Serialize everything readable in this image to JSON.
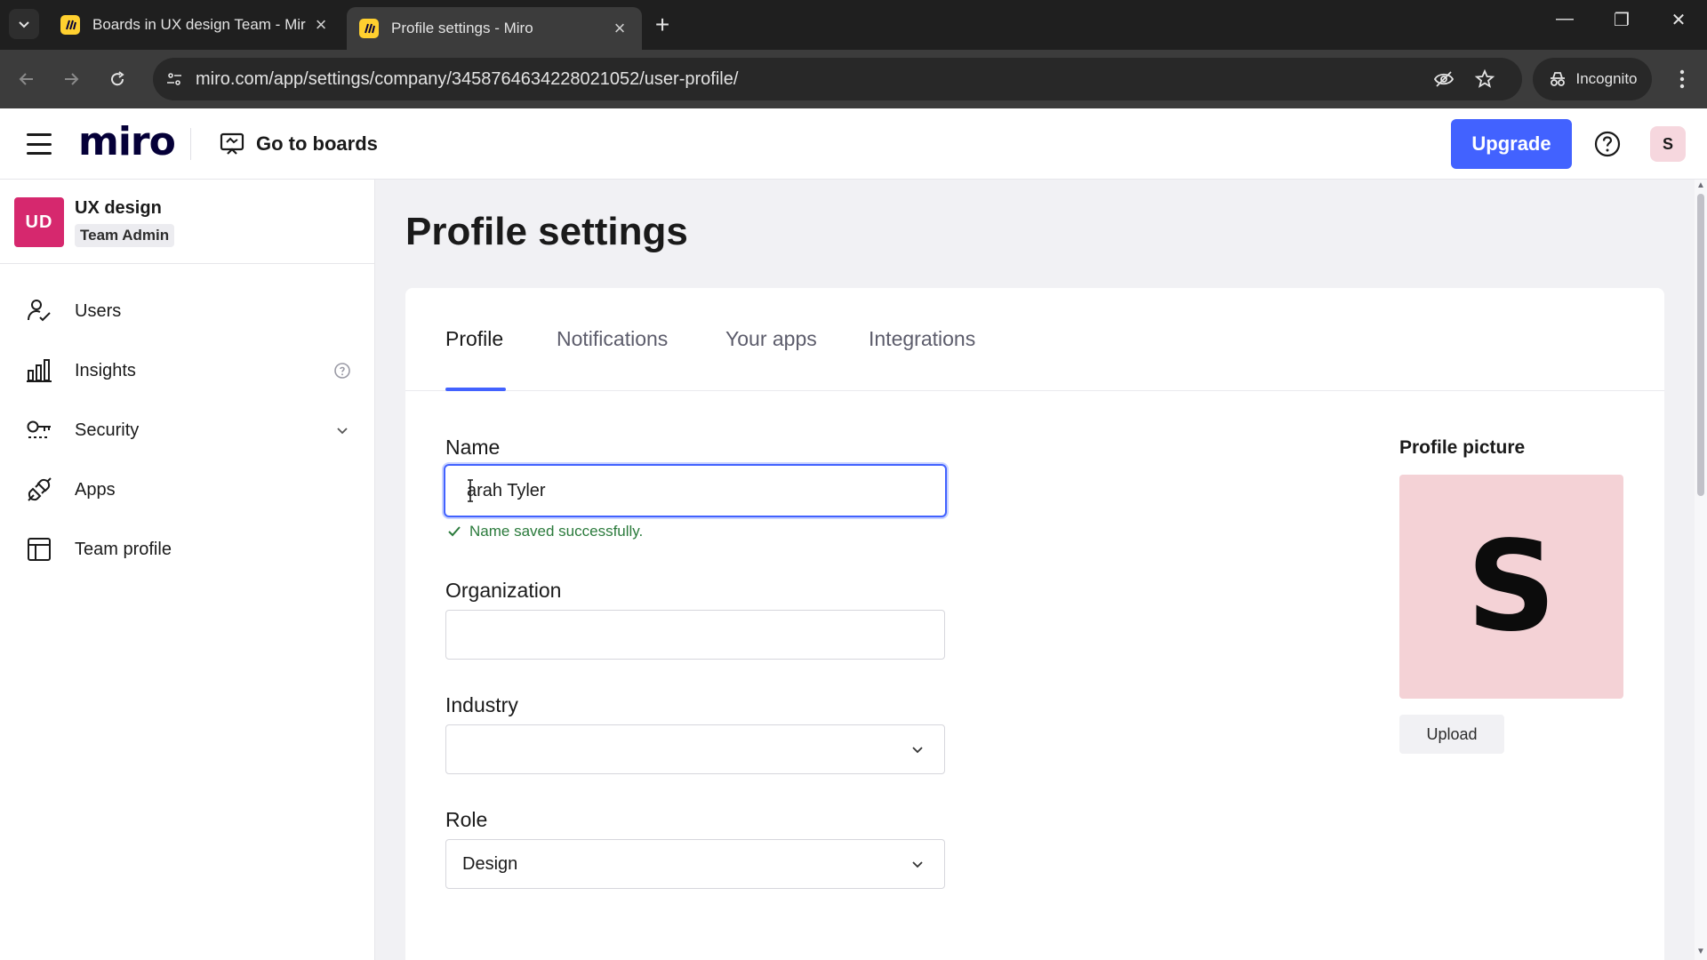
{
  "browser": {
    "tabs": [
      {
        "title": "Boards in UX design Team - Mir",
        "active": false
      },
      {
        "title": "Profile settings - Miro",
        "active": true
      }
    ],
    "url": "miro.com/app/settings/company/3458764634228021052/user-profile/",
    "incognito_label": "Incognito"
  },
  "header": {
    "logo": "miro",
    "go_to_boards": "Go to boards",
    "upgrade": "Upgrade",
    "avatar_initial": "S"
  },
  "sidebar": {
    "team": {
      "initials": "UD",
      "name": "UX design",
      "role": "Team Admin"
    },
    "items": [
      {
        "label": "Users",
        "icon": "user-check-icon"
      },
      {
        "label": "Insights",
        "icon": "bar-chart-icon"
      },
      {
        "label": "Security",
        "icon": "key-icon"
      },
      {
        "label": "Apps",
        "icon": "plug-icon"
      },
      {
        "label": "Team profile",
        "icon": "layout-icon"
      }
    ]
  },
  "main": {
    "title": "Profile settings",
    "tabs": [
      "Profile",
      "Notifications",
      "Your apps",
      "Integrations"
    ],
    "active_tab": "Profile",
    "form": {
      "name_label": "Name",
      "name_value": "Sarah Tyler",
      "name_display": "arah Tyler",
      "success_message": "Name saved successfully.",
      "organization_label": "Organization",
      "organization_value": "",
      "industry_label": "Industry",
      "industry_value": "",
      "role_label": "Role",
      "role_value": "Design"
    },
    "profile_picture": {
      "label": "Profile picture",
      "initial": "S",
      "upload": "Upload"
    }
  },
  "colors": {
    "accent": "#4262ff",
    "team_badge": "#d6286e",
    "avatar_bg": "#f4d2d6",
    "success": "#2a7a3b"
  }
}
